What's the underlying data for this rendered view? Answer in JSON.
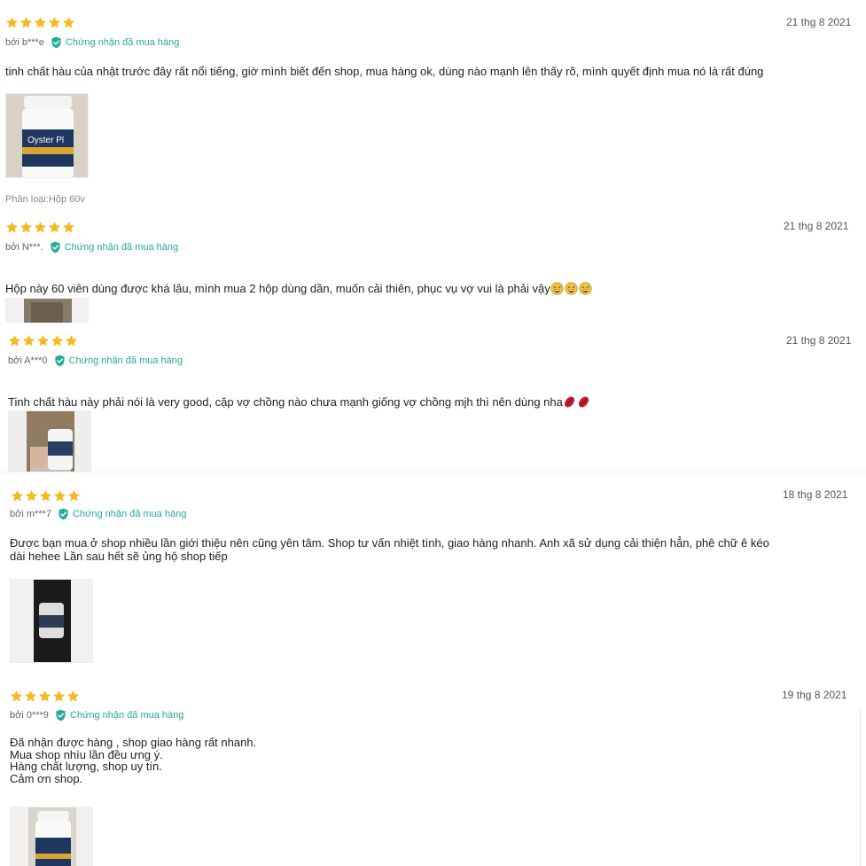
{
  "colors": {
    "star": "#f5b81e",
    "verified": "#26aa99",
    "date": "#555555",
    "text": "#222222"
  },
  "icons": {
    "star": "star-icon",
    "verified": "shield-check-icon"
  },
  "reviews": [
    {
      "rating": 5,
      "date": "21 thg 8 2021",
      "author": "bởi b***e",
      "verified_label": "Chứng nhận đã mua hàng",
      "comment": "tinh chất hàu của nhật trước đây rất nổi tiếng, giờ mình biết đến shop, mua hàng ok, dùng nào mạnh lên thấy rõ, mình quyết định mua nó là rất đúng",
      "variation": "Phân loại:Hộp 60v",
      "photo_label": "Oyster Pl"
    },
    {
      "rating": 5,
      "date": "21 thg 8 2021",
      "author": "bởi N***.",
      "verified_label": "Chứng nhận đã mua hàng",
      "comment": "Hộp này 60 viên dùng được khá lâu, mình mua 2 hộp dùng dần, muốn cải thiên, phục vụ vợ  vui là phải vậy",
      "emoji": [
        "grinning-sweat-emoji",
        "grinning-sweat-emoji",
        "grinning-sweat-emoji"
      ]
    },
    {
      "rating": 5,
      "date": "21 thg 8 2021",
      "author": "bởi A***0",
      "verified_label": "Chứng nhận đã mua hàng",
      "comment": "Tinh chất hàu này phải nói là very good, cặp vợ chồng nào chưa mạnh giống vợ chồng mjh thì nên dùng nha",
      "emoji": [
        "kiss-lips-emoji",
        "kiss-lips-emoji"
      ]
    },
    {
      "rating": 5,
      "date": "18 thg 8 2021",
      "author": "bởi m***7",
      "verified_label": "Chứng nhận đã mua hàng",
      "comment": "Được bạn mua ở shop nhiều lần giới thiệu nên cũng yên tâm. Shop tư vấn nhiệt tình, giao hàng nhanh. Anh xã sử dụng cải thiện hẳn, phê chữ ê kéo\ndài hehee Lần sau hết sẽ ủng hộ shop tiếp"
    },
    {
      "rating": 5,
      "date": "19 thg 8 2021",
      "author": "bởi 0***9",
      "verified_label": "Chứng nhận đã mua hàng",
      "comment": "Đã nhận được hàng , shop giao hàng rất nhanh.\nMua shop nhìu lần đều ưng ý.\nHàng chất lượng, shop uy tín.\nCảm ơn shop."
    }
  ]
}
